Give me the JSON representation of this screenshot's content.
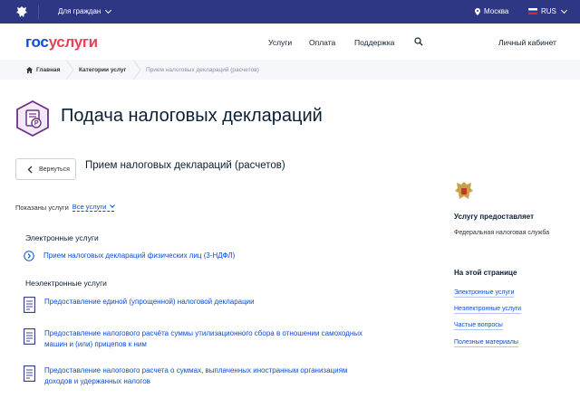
{
  "topbar": {
    "citizens_label": "Для граждан",
    "city": "Москва",
    "lang": "RUS"
  },
  "header": {
    "logo_gos": "гос",
    "logo_uslugi": "услуги",
    "nav": [
      "Услуги",
      "Оплата",
      "Поддержка"
    ],
    "cabinet": "Личный кабинет"
  },
  "breadcrumb": {
    "home": "Главная",
    "category": "Категории услуг",
    "current": "Прием налоговых деклараций (расчетов)"
  },
  "page": {
    "title": "Подача налоговых деклараций",
    "back_label": "Вернуться",
    "subtitle": "Прием налоговых деклараций (расчетов)"
  },
  "filter": {
    "label": "Показаны услуги",
    "value": "Все услуги"
  },
  "electronic": {
    "heading": "Электронные услуги",
    "items": [
      "Прием налоговых деклараций физических лиц (3-НДФЛ)"
    ]
  },
  "non_electronic": {
    "heading": "Неэлектронные услуги",
    "items": [
      [
        "Предоставление единой (упрощенной) налоговой декларации"
      ],
      [
        "Предоставление налогового расчёта суммы утилизационного сбора в отношении самоходных",
        "машин и (или) прицепов к ним"
      ],
      [
        "Предоставление налогового расчета о суммах, выплаченных иностранным организациям",
        "доходов и удержанных налогов"
      ]
    ]
  },
  "aside": {
    "provider_heading": "Услугу предоставляет",
    "provider": "Федеральная налоговая служба",
    "on_page_heading": "На этой странице",
    "links": [
      "Электронные услуги",
      "Неэлектронные услуги",
      "Частые вопросы",
      "Полезные материалы"
    ]
  },
  "colors": {
    "topbar": "#2d3784",
    "link": "#0d4cd3",
    "brand_blue": "#0d4cd3",
    "brand_red": "#ee3f58",
    "icon_purple": "#6e2f8a"
  }
}
